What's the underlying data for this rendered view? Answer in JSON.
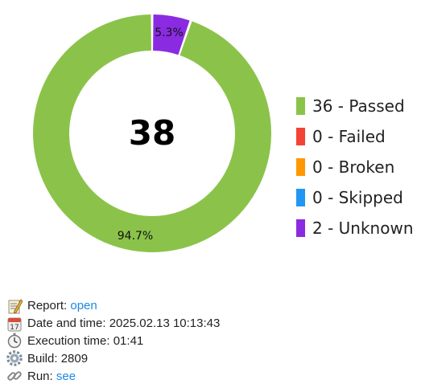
{
  "chart_data": {
    "type": "pie",
    "center_label": "38",
    "slices": [
      {
        "label": "Unknown",
        "value": 2,
        "color": "#8a2be2",
        "pct_label": "5.3%"
      },
      {
        "label": "Passed",
        "value": 36,
        "color": "#8bc34a",
        "pct_label": "94.7%"
      }
    ],
    "legend": [
      {
        "text": "36 - Passed",
        "color": "#8bc34a"
      },
      {
        "text": "0 - Failed",
        "color": "#f44336"
      },
      {
        "text": "0 - Broken",
        "color": "#ff9800"
      },
      {
        "text": "0 - Skipped",
        "color": "#2196f3"
      },
      {
        "text": "2 - Unknown",
        "color": "#8a2be2"
      }
    ],
    "legend_placement": "right"
  },
  "info": {
    "report": {
      "label": "Report:",
      "link": "open",
      "icon": "memo-icon"
    },
    "date": {
      "label": "Date and time: 2025.02.13 10:13:43",
      "icon": "calendar-icon"
    },
    "execution": {
      "label": "Execution time: 01:41",
      "icon": "stopwatch-icon"
    },
    "build": {
      "label": "Build: 2809",
      "icon": "gear-icon"
    },
    "run": {
      "label": "Run:",
      "link": "see",
      "icon": "link-icon"
    }
  }
}
